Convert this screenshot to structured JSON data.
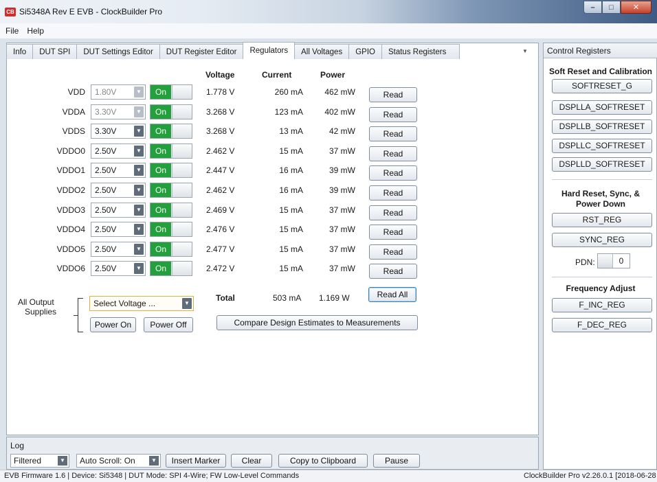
{
  "window": {
    "logo": "CB",
    "title": "Si5348A Rev E EVB - ClockBuilder Pro",
    "min_glyph": "–",
    "max_glyph": "□",
    "close_glyph": "✕"
  },
  "menu": [
    "File",
    "Help"
  ],
  "tabs": [
    {
      "label": "Info"
    },
    {
      "label": "DUT SPI"
    },
    {
      "label": "DUT Settings Editor"
    },
    {
      "label": "DUT Register Editor"
    },
    {
      "label": "Regulators",
      "active": true
    },
    {
      "label": "All Voltages"
    },
    {
      "label": "GPIO"
    },
    {
      "label": "Status Registers"
    }
  ],
  "tab_overflow_icon": "chevron-down-icon",
  "regulators": {
    "headers": {
      "voltage": "Voltage",
      "current": "Current",
      "power": "Power"
    },
    "toggle_label": "On",
    "read_label": "Read",
    "rows": [
      {
        "name": "VDD",
        "setting": "1.80V",
        "disabled": true,
        "voltage": "1.778 V",
        "current": "260 mA",
        "power": "462 mW"
      },
      {
        "name": "VDDA",
        "setting": "3.30V",
        "disabled": true,
        "voltage": "3.268 V",
        "current": "123 mA",
        "power": "402 mW"
      },
      {
        "name": "VDDS",
        "setting": "3.30V",
        "disabled": false,
        "voltage": "3.268 V",
        "current": "13 mA",
        "power": "42 mW"
      },
      {
        "name": "VDDO0",
        "setting": "2.50V",
        "disabled": false,
        "voltage": "2.462 V",
        "current": "15 mA",
        "power": "37 mW"
      },
      {
        "name": "VDDO1",
        "setting": "2.50V",
        "disabled": false,
        "voltage": "2.447 V",
        "current": "16 mA",
        "power": "39 mW"
      },
      {
        "name": "VDDO2",
        "setting": "2.50V",
        "disabled": false,
        "voltage": "2.462 V",
        "current": "16 mA",
        "power": "39 mW"
      },
      {
        "name": "VDDO3",
        "setting": "2.50V",
        "disabled": false,
        "voltage": "2.469 V",
        "current": "15 mA",
        "power": "37 mW"
      },
      {
        "name": "VDDO4",
        "setting": "2.50V",
        "disabled": false,
        "voltage": "2.476 V",
        "current": "15 mA",
        "power": "37 mW"
      },
      {
        "name": "VDDO5",
        "setting": "2.50V",
        "disabled": false,
        "voltage": "2.477 V",
        "current": "15 mA",
        "power": "37 mW"
      },
      {
        "name": "VDDO6",
        "setting": "2.50V",
        "disabled": false,
        "voltage": "2.472 V",
        "current": "15 mA",
        "power": "37 mW"
      }
    ],
    "total": {
      "label": "Total",
      "current": "503 mA",
      "power": "1.169 W",
      "read_all": "Read All"
    },
    "all_output": {
      "label_line1": "All Output",
      "label_line2": "Supplies",
      "select_placeholder": "Select Voltage ...",
      "power_on": "Power On",
      "power_off": "Power Off"
    },
    "compare_button": "Compare Design Estimates to Measurements"
  },
  "control_registers": {
    "title": "Control Registers",
    "soft_reset_heading": "Soft Reset and Calibration",
    "soft_reset_buttons": [
      "SOFTRESET_G",
      "DSPLLA_SOFTRESET",
      "DSPLLB_SOFTRESET",
      "DSPLLC_SOFTRESET",
      "DSPLLD_SOFTRESET"
    ],
    "hard_reset_heading_line1": "Hard Reset, Sync, &",
    "hard_reset_heading_line2": "Power Down",
    "rst_reg": "RST_REG",
    "sync_reg": "SYNC_REG",
    "pdn_label": "PDN:",
    "pdn_value": "0",
    "freq_heading": "Frequency Adjust",
    "f_inc": "F_INC_REG",
    "f_dec": "F_DEC_REG"
  },
  "log": {
    "label": "Log",
    "filter": "Filtered",
    "autoscroll": "Auto Scroll: On",
    "insert_marker": "Insert Marker",
    "clear": "Clear",
    "copy": "Copy to Clipboard",
    "pause": "Pause"
  },
  "status": {
    "left": "EVB Firmware 1.6 | Device: Si5348 | DUT Mode: SPI 4-Wire; FW Low-Level Commands",
    "right": "ClockBuilder Pro v2.26.0.1 [2018-06-28"
  },
  "colors": {
    "on_green": "#22a03c",
    "accent_blue": "#3c7fb1"
  }
}
